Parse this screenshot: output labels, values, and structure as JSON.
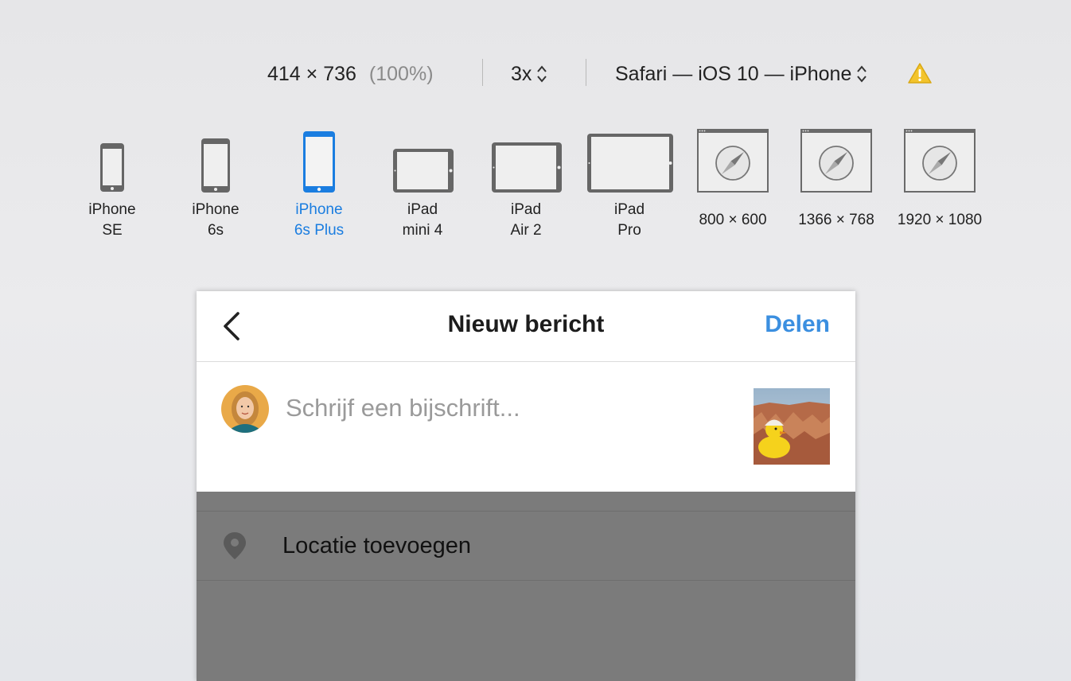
{
  "toolbar": {
    "dimensions": "414 × 736",
    "zoom": "(100%)",
    "scale": "3x",
    "user_agent": "Safari — iOS 10 — iPhone"
  },
  "devices": [
    {
      "line1": "iPhone",
      "line2": "SE"
    },
    {
      "line1": "iPhone",
      "line2": "6s"
    },
    {
      "line1": "iPhone",
      "line2": "6s Plus"
    },
    {
      "line1": "iPad",
      "line2": "mini 4"
    },
    {
      "line1": "iPad",
      "line2": "Air 2"
    },
    {
      "line1": "iPad",
      "line2": "Pro"
    },
    {
      "line1": "800 × 600"
    },
    {
      "line1": "1366 × 768"
    },
    {
      "line1": "1920 × 1080"
    }
  ],
  "selected_device": "iPhone 6s Plus",
  "app": {
    "title": "Nieuw bericht",
    "share_label": "Delen",
    "caption_placeholder": "Schrijf een bijschrift...",
    "location_label": "Locatie toevoegen"
  },
  "colors": {
    "accent_blue": "#3b8fe0",
    "selected_device": "#1a7de0",
    "overlay_gray": "#7b7b7b",
    "warning": "#f3c42c"
  },
  "icons": {
    "back": "chevron-left-icon",
    "location": "location-pin-icon",
    "warning": "warning-triangle-icon",
    "stepper": "up-down-chevron-icon"
  }
}
